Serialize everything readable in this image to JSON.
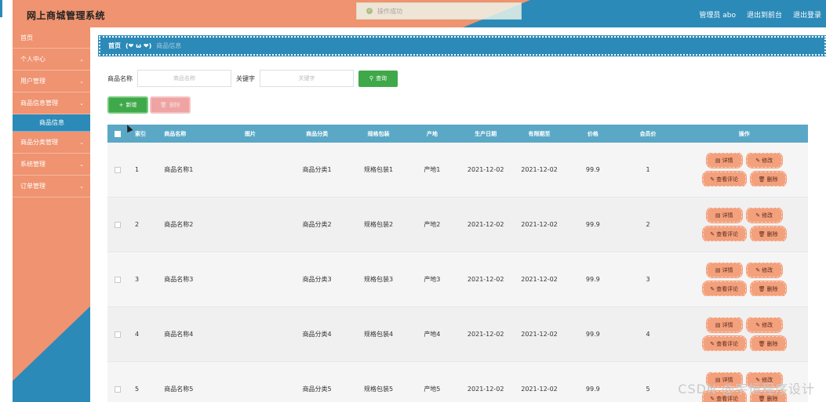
{
  "header": {
    "title": "网上商城管理系统",
    "admin_label": "管理员 abo",
    "back_front": "退出到前台",
    "logout": "退出登录",
    "toast": "操作成功"
  },
  "sidebar": {
    "items": [
      {
        "label": "首页",
        "chevron": false
      },
      {
        "label": "个人中心",
        "chevron": true
      },
      {
        "label": "用户管理",
        "chevron": true
      },
      {
        "label": "商品信息管理",
        "chevron": true
      },
      {
        "label": "商品分类管理",
        "chevron": true
      },
      {
        "label": "系统管理",
        "chevron": true
      },
      {
        "label": "订单管理",
        "chevron": true
      }
    ],
    "sub_item": "商品信息"
  },
  "breadcrumb": {
    "home": "首页",
    "emoji": "(❤ ω ❤)",
    "current": "商品信息"
  },
  "search": {
    "name_label": "商品名称",
    "name_placeholder": "商品名称",
    "keyword_label": "关键字",
    "keyword_placeholder": "关键字",
    "button": "查询"
  },
  "toolbar": {
    "add": "新增",
    "delete": "删除"
  },
  "table": {
    "columns": [
      "索引",
      "商品名称",
      "图片",
      "商品分类",
      "规格包装",
      "产地",
      "生产日期",
      "有限期至",
      "价格",
      "会员价",
      "操作"
    ],
    "rows": [
      {
        "idx": "1",
        "name": "商品名称1",
        "cat": "商品分类1",
        "spec": "规格包装1",
        "origin": "产地1",
        "prod": "2021-12-02",
        "exp": "2021-12-02",
        "price": "99.9",
        "member": "1"
      },
      {
        "idx": "2",
        "name": "商品名称2",
        "cat": "商品分类2",
        "spec": "规格包装2",
        "origin": "产地2",
        "prod": "2021-12-02",
        "exp": "2021-12-02",
        "price": "99.9",
        "member": "2"
      },
      {
        "idx": "3",
        "name": "商品名称3",
        "cat": "商品分类3",
        "spec": "规格包装3",
        "origin": "产地3",
        "prod": "2021-12-02",
        "exp": "2021-12-02",
        "price": "99.9",
        "member": "3"
      },
      {
        "idx": "4",
        "name": "商品名称4",
        "cat": "商品分类4",
        "spec": "规格包装4",
        "origin": "产地4",
        "prod": "2021-12-02",
        "exp": "2021-12-02",
        "price": "99.9",
        "member": "4"
      },
      {
        "idx": "5",
        "name": "商品名称5",
        "cat": "商品分类5",
        "spec": "规格包装5",
        "origin": "产地5",
        "prod": "2021-12-02",
        "exp": "2021-12-02",
        "price": "99.9",
        "member": "5"
      }
    ],
    "ops": {
      "detail": "详情",
      "edit": "修改",
      "comments": "查看评论",
      "delete": "删除"
    }
  },
  "watermark": "CSDN @宇恒程序设计",
  "colors": {
    "orange": "#ef9370",
    "blue": "#2b8ab8",
    "green": "#3fa94a",
    "op_button": "#f3a07c"
  }
}
